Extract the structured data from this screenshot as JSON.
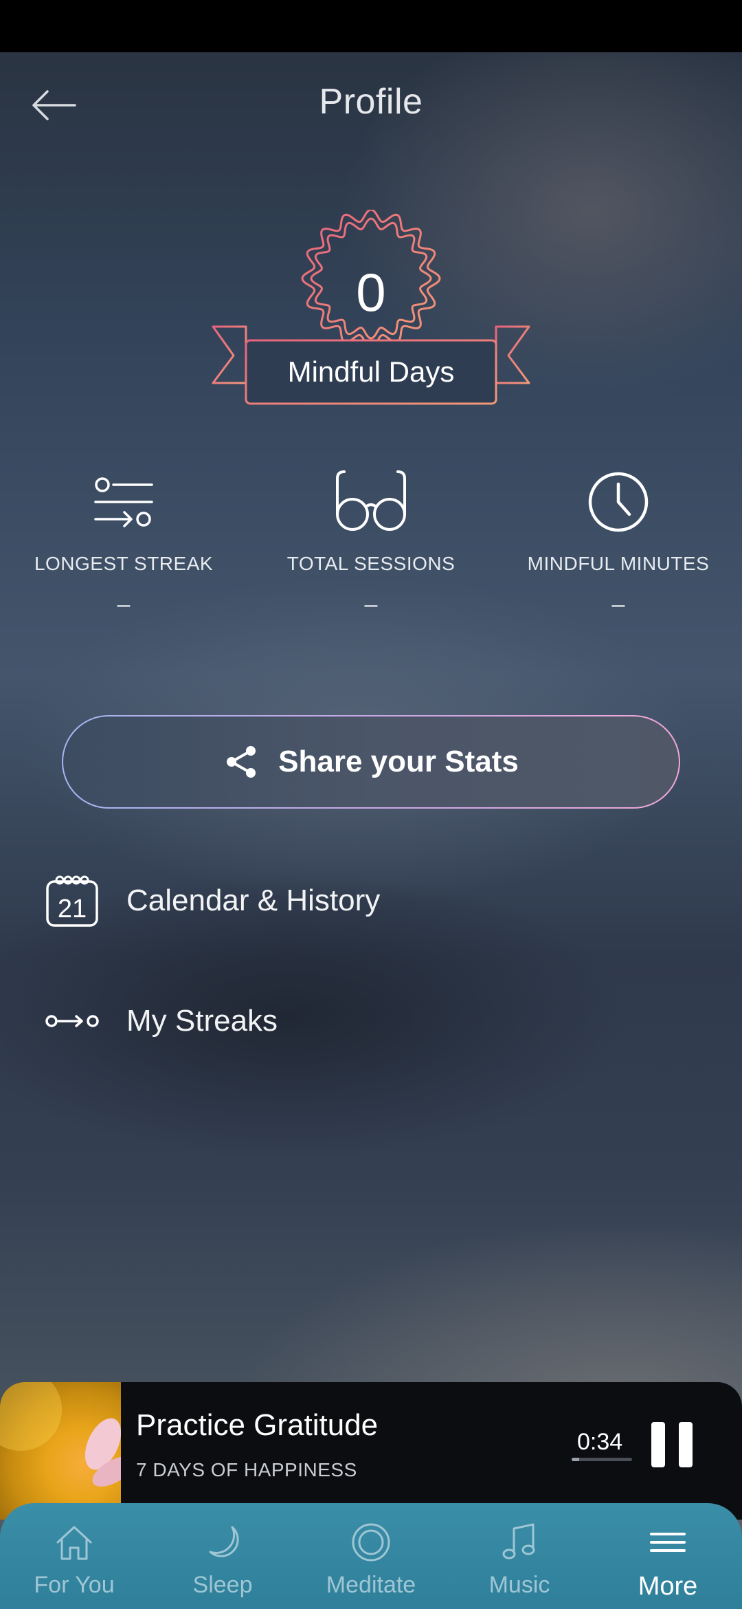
{
  "header": {
    "title": "Profile"
  },
  "badge": {
    "count": "0",
    "label": "Mindful Days"
  },
  "stats": [
    {
      "label": "LONGEST STREAK",
      "value": "–",
      "icon": "streak-icon"
    },
    {
      "label": "TOTAL SESSIONS",
      "value": "–",
      "icon": "glasses-icon"
    },
    {
      "label": "MINDFUL MINUTES",
      "value": "–",
      "icon": "clock-icon"
    }
  ],
  "share": {
    "label": "Share your Stats"
  },
  "menu": [
    {
      "label": "Calendar & History",
      "icon": "calendar-icon",
      "icon_text": "21"
    },
    {
      "label": "My Streaks",
      "icon": "streaks-icon"
    }
  ],
  "player": {
    "title": "Practice Gratitude",
    "subtitle": "7 DAYS OF HAPPINESS",
    "time": "0:34",
    "progress": 0.12
  },
  "tabs": [
    {
      "label": "For You",
      "icon": "home-icon"
    },
    {
      "label": "Sleep",
      "icon": "moon-icon"
    },
    {
      "label": "Meditate",
      "icon": "meditate-icon"
    },
    {
      "label": "Music",
      "icon": "music-note-icon"
    },
    {
      "label": "More",
      "icon": "menu-icon",
      "active": true
    }
  ],
  "colors": {
    "badge_gradient_start": "#e8647e",
    "badge_gradient_end": "#f29a78",
    "share_border_start": "#a7b6f2",
    "share_border_end": "#f0a8d8",
    "tabbar": "#3386a1"
  }
}
